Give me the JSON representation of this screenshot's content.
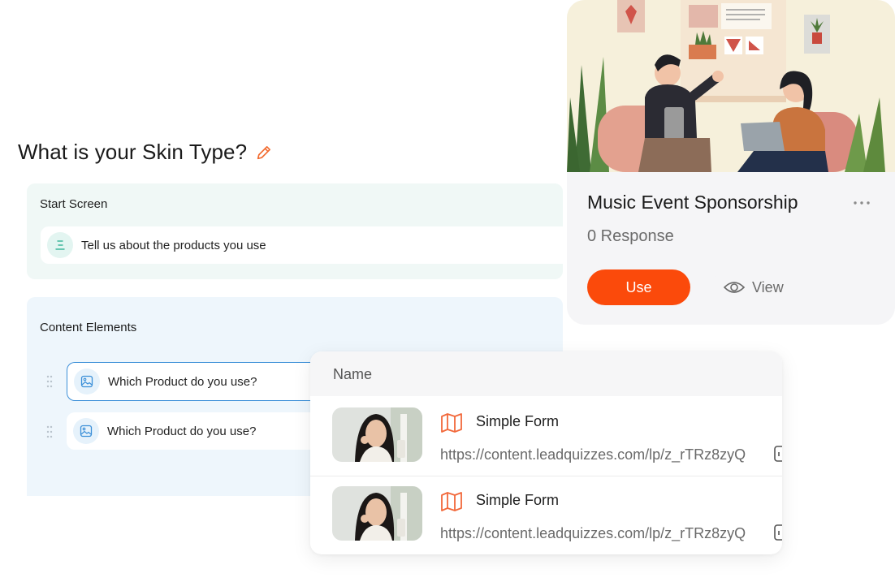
{
  "question": {
    "title": "What is your Skin Type?"
  },
  "start_screen": {
    "heading": "Start Screen",
    "item_label": "Tell us about the products you use"
  },
  "content_elements": {
    "heading": "Content Elements",
    "items": [
      {
        "label": "Which Product do you use?",
        "selected": true
      },
      {
        "label": "Which Product do you use?",
        "selected": false
      }
    ]
  },
  "template_card": {
    "title": "Music Event Sponsorship",
    "responses": "0 Response",
    "use_label": "Use",
    "view_label": "View"
  },
  "forms_table": {
    "column_name": "Name",
    "rows": [
      {
        "name": "Simple Form",
        "url": "https://content.leadquizzes.com/lp/z_rTRz8zyQ"
      },
      {
        "name": "Simple Form",
        "url": "https://content.leadquizzes.com/lp/z_rTRz8zyQ"
      }
    ]
  },
  "colors": {
    "accent_orange": "#fb4a0b",
    "selected_border": "#3b8fd8",
    "start_panel_bg": "#f0f8f6",
    "content_panel_bg": "#eef6fc"
  },
  "icons": [
    "pencil-icon",
    "text-lines-icon",
    "image-icon",
    "drag-handle-icon",
    "more-icon",
    "eye-icon",
    "map-icon",
    "copy-icon"
  ]
}
